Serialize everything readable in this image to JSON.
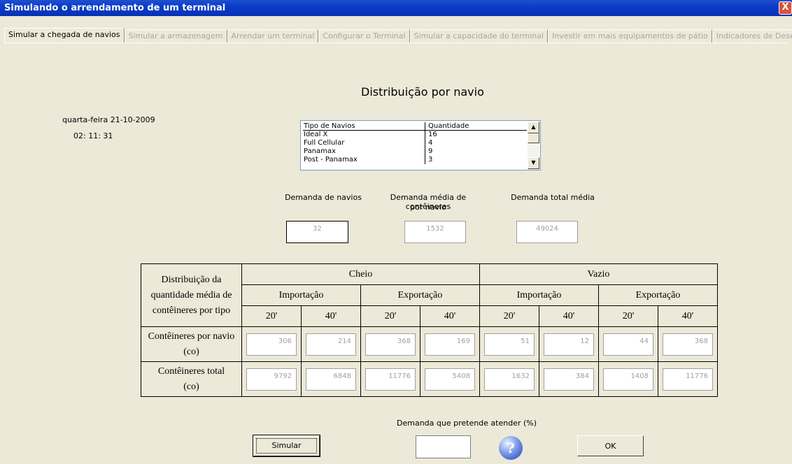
{
  "window": {
    "title": "Simulando o arrendamento de um terminal",
    "close": "X"
  },
  "tabs": [
    "Simular a chegada de navios",
    "Simular a armazenagem",
    "Arrendar um terminal",
    "Configurar o Terminal",
    "Simular a capacidade do terminal",
    "Investir em mais equipamentos de pátio",
    "Indicadores de Desempenho"
  ],
  "heading": "Distribuição por navio",
  "clock": {
    "date": "quarta-feira 21-10-2009",
    "time": "02: 11: 31"
  },
  "ships_list": {
    "headers": [
      "Tipo de Navios",
      "Quantidade"
    ],
    "rows": [
      [
        "Ideal X",
        "16"
      ],
      [
        "Full Cellular",
        "4"
      ],
      [
        "Panamax",
        "9"
      ],
      [
        "Post - Panamax",
        "3"
      ]
    ]
  },
  "demand": {
    "ships_label": "Demanda de navios",
    "ships_value": "32",
    "avg_label_1": "Demanda média de contêineres",
    "avg_label_2": "por navio",
    "avg_value": "1532",
    "total_label": "Demanda total média",
    "total_value": "49024"
  },
  "table": {
    "corner": [
      "Distribuição da",
      "quantidade média de",
      "contêineres por tipo"
    ],
    "groups": [
      "Cheio",
      "Vazio"
    ],
    "subgroups": [
      "Importação",
      "Exportação",
      "Importação",
      "Exportação"
    ],
    "sizes": [
      "20'",
      "40'",
      "20'",
      "40'",
      "20'",
      "40'",
      "20'",
      "40'"
    ],
    "rows": [
      {
        "label1": "Contêineres por navio",
        "label2": "(co)",
        "values": [
          "306",
          "214",
          "368",
          "169",
          "51",
          "12",
          "44",
          "368"
        ]
      },
      {
        "label1": "Contêineres total",
        "label2": "(co)",
        "values": [
          "9792",
          "6848",
          "11776",
          "5408",
          "1632",
          "384",
          "1408",
          "11776"
        ]
      }
    ]
  },
  "footer": {
    "percent_label": "Demanda que pretende atender (%)",
    "percent_value": "",
    "simulate": "Simular",
    "help": "?",
    "ok": "OK"
  }
}
